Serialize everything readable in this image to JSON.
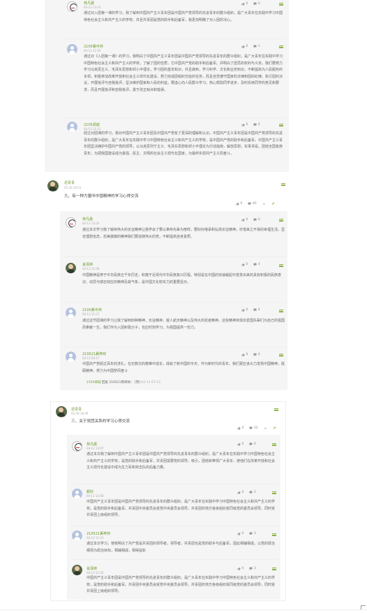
{
  "post1": {
    "comments": [
      {
        "name": "林凡晨",
        "date": "04-13 13:24",
        "likes": "0",
        "comments": "0",
        "text": "通过对入团第一课的学习，我了解到中国共产主义青年团是中国共产党领导的先进青年的群众组织，是广大青年在实践中学习中国特色社会主义和共产主义的学校，并且共青团是党的助手和后备军，我更加明确了对入团的决心。"
      },
      {
        "name": "2105裹中帅",
        "date": "04-13 11:02",
        "likes": "0",
        "comments": "1",
        "text": "通过对《入团第一课》的学习，我明白了中国共产主义青年团是中国共产党领导的先进青年的群众组织，是广大青年在实践中学习中国特色社会主义和共产主义的学校，了解了团的性质，它中国共产党的助手和后备军。并明白了团员的权利与义务。我们要努力学习马克思主义、毛泽东思想和邓小平理论，学习团的基本知识，并且做到，学习科学、文化和业务知识，不断提高为人民服务的本领，积极参加改革开放和社会主义现代化建设，努力完成团组织交给的任务，而且自觉遵守国家的法律和团的纪律，执行团的决议，开展批评与自我批评，坚决维护国家和人民的利益，要虚心向人民群众学习，热心帮助同学进步，及时反映同学的意见和要求，而且开展批评和自我批评，勇于改正缺点和错误。"
      },
      {
        "name": "2105郑诚",
        "date": "04-13 11:21",
        "likes": "0",
        "comments": "4",
        "text": "经过对团课的学习，我对中国共产主义青年团及中国共产党有了更深的理解和认识。中国共产主义青年团是中国共产党领导的先进青年的群众组织，是广大青年在实践中学习中国特色社会主义和共产主义的学校，是中国共产党的助手和后备军。中国共产主义青年团坚决拥护中国共产党的领导，以马克思列宁主义、毛泽东思想和邓小平理论为行动指南，解放思想，实事求是，团结全国各族青年，为把我国建设成为富强、民主、文明的社会主义现代化国家，为最终实现共产主义而奋斗。"
      }
    ]
  },
  "post2": {
    "author": "迟青青",
    "date": "03-30 16:51",
    "text": "九、有一种力量叫中国精神的学习心得交流",
    "likes": "0",
    "comments": "40",
    "comments_panel": [
      {
        "name": "林凡晨",
        "date": "04-13 13:24",
        "likes": "0",
        "comments": "0",
        "text": "通过本次学习我了解到伟大的长征精神让我学会了要以革命先辈为榜样，要好好继承和弘扬长征精神，珍惜来之不易的幸福生活，坚定理想信念，抗美援朝的精神我们要追随伟大的党，不断提高自身素质。"
      },
      {
        "name": "肖泽婷",
        "date": "04-13 11:08",
        "likes": "0",
        "comments": "4",
        "text": "中国精神是穿于中华民族五千年历史，积蕴于近现代中华民族复兴历程，特别是在中国的快速崛起中迸发出来的具有积极的民族意识、动员与感召效应的精神及其气象，是中国文化软实力的重要显示。"
      },
      {
        "name": "2105裹中帅",
        "date": "04-13 11:27",
        "likes": "0",
        "comments": "4",
        "text": "通过这节团课的学习让我了解到四种精神，长征精神，载人航天精神以及伟大的抗疫精神。这些精神体现出爱国先辈们为自己的祖国而奉献一生，我们作为入团积极分子，也应时刻学习，为祖国提供一份力。"
      },
      {
        "name": "210521裹梓帅",
        "date": "04-13 09:17",
        "likes": "0",
        "comments": "4",
        "text": "中国共产党经过百年的洗礼，在无数次的磨难中成长，成就了新中国的今天，作为新时代的青年，我们更应该大力发扬中国精神，砥砺精神，努力为中国梦而奋斗"
      }
    ],
    "reply": {
      "from": "2105郑诚",
      "verb": "回复",
      "to": "210521裹梓帅：",
      "content": "[赞]",
      "date": "04-13 07:13"
    }
  },
  "post3": {
    "author": "迟青青",
    "date": "03-30 16:49",
    "text": "三、关于党团关系的学习心得交流",
    "likes": "0",
    "comments": "32",
    "comments_panel": [
      {
        "name": "林凡晨",
        "date": "04-13 13:07",
        "likes": "0",
        "comments": "0",
        "text": "通过本次我了解到中国共产主义青年团是中国共产党领导的先进青年的群众组织，是广大青年在实践中学习中国特色社会主义和共产主义的学校，是党的助手和后备军，共青团需要党的领导，吸引，团结和带领广大青年，使他们在改革开放和社会主义现代化建设中成为生力军和突击队的后备力量。"
      },
      {
        "name": "颜好",
        "date": "04-13 12:58",
        "likes": "0",
        "comments": "2",
        "text": "中国共产主义青年团是中国共产党领导的先进青年的群众组织，是广大青年在实践中学习中国特色社会主义和共产主义的学校，是党的助手和后备军。共青团中央委员会受党中央委员会领导，共青团的地方各级组织受同级党的委员会领导，同时受共青团上级组织领导。"
      },
      {
        "name": "210521裹梓帅",
        "date": "04-13 11:23",
        "likes": "0",
        "comments": "3",
        "text": "通过本次学习，使我明白了共产党是共青团的领导者，领导者，共青团也是党的助手与后备军，因此相辅相成，以党的政治纲领为政治目标，相辅相成，相得益彰"
      },
      {
        "name": "肖泽婷",
        "date": "04-13 11:03",
        "likes": "0",
        "comments": "3",
        "text": "中国共产主义青年团是中国共产党领导的先进青年的群众组织，是广大青年在实践中学习中国特色社会主义和共产主义的学校，是党的助手和后备军。共青团中央委员会受党中央委员会领导，共青团的地方各级组织受同级党的委员会领导，同时受共青团上级组织领导。"
      }
    ]
  },
  "colors": {
    "accent": "#8ab13f",
    "name_green": "#6a9a2a",
    "panel_bg": "#f5f5f5"
  }
}
